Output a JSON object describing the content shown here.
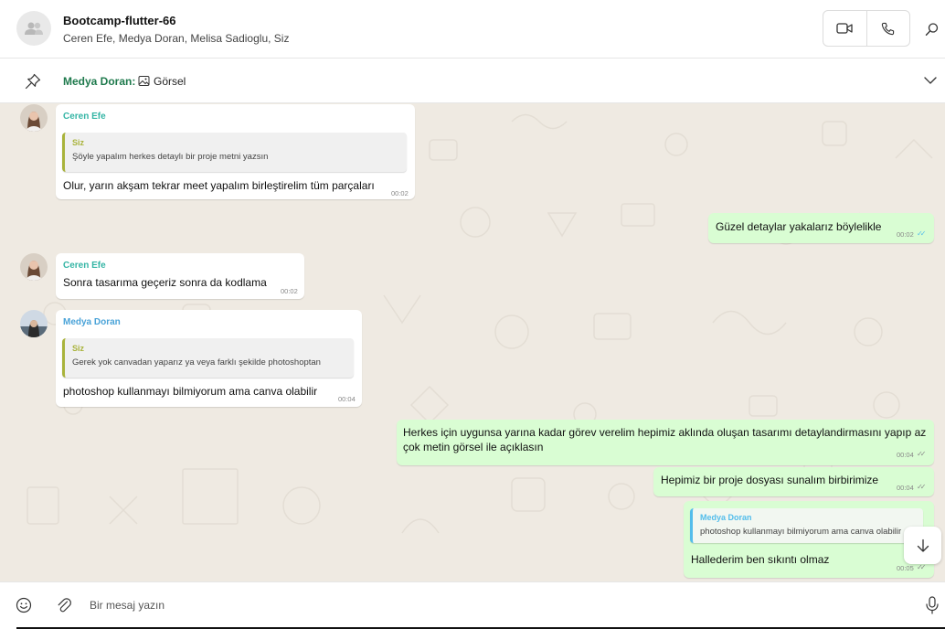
{
  "header": {
    "title": "Bootcamp-flutter-66",
    "members": "Ceren Efe, Medya Doran, Melisa Sadioglu, Siz",
    "icons": [
      "group-avatar-icon",
      "video-call-icon",
      "voice-call-icon",
      "search-icon"
    ]
  },
  "pinned": {
    "sender": "Medya Doran:",
    "text": "Görsel",
    "icons": [
      "pin-icon",
      "image-icon",
      "chevron-down-icon"
    ]
  },
  "messages": [
    {
      "direction": "in",
      "sender": "Ceren Efe",
      "quote_author": "Siz",
      "quote_text": "Şöyle yapalım herkes detaylı bir proje metni yazsın",
      "text": "Olur, yarın akşam tekrar meet yapalım birleştirelim tüm parçaları",
      "time": "00:02"
    },
    {
      "direction": "out",
      "text": "Güzel detaylar yakalarız böylelikle",
      "time": "00:02",
      "status": "read"
    },
    {
      "direction": "in",
      "sender": "Ceren Efe",
      "text": "Sonra tasarıma geçeriz sonra da kodlama",
      "time": "00:02"
    },
    {
      "direction": "in",
      "sender": "Medya Doran",
      "quote_author": "Siz",
      "quote_text": "Gerek yok canvadan yaparız ya veya farklı şekilde photoshoptan",
      "text": "photoshop kullanmayı bilmiyorum ama canva olabilir",
      "time": "00:04"
    },
    {
      "direction": "out",
      "text_line1": "Herkes için uygunsa yarına kadar görev verelim hepimiz aklında oluşan tasarımı detaylandirmasını yapıp az",
      "text_line2": "çok metin görsel ile açıklasın",
      "time": "00:04",
      "status": "delivered"
    },
    {
      "direction": "out",
      "text": "Hepimiz bir proje dosyası sunalım birbirimize",
      "time": "00:04",
      "status": "delivered"
    },
    {
      "direction": "out",
      "quote_author": "Medya Doran",
      "quote_text": "photoshop kullanmayı bilmiyorum ama canva olabilir",
      "text": "Hallederim ben sıkıntı olmaz",
      "time": "00:05",
      "status": "delivered"
    }
  ],
  "colors": {
    "sender_ceren": "#35b5a5",
    "sender_medya": "#4aa3d8",
    "quote_siz": "#a9b33b",
    "quote_medya": "#53bdeb",
    "outgoing_bubble": "#d9fdd3",
    "chat_background": "#efeae2",
    "pinned_sender": "#1f7a4d"
  },
  "composer": {
    "placeholder": "Bir mesaj yazın",
    "icons": [
      "emoji-icon",
      "attach-icon",
      "microphone-icon"
    ]
  },
  "scroll_button_icon": "arrow-down-icon"
}
